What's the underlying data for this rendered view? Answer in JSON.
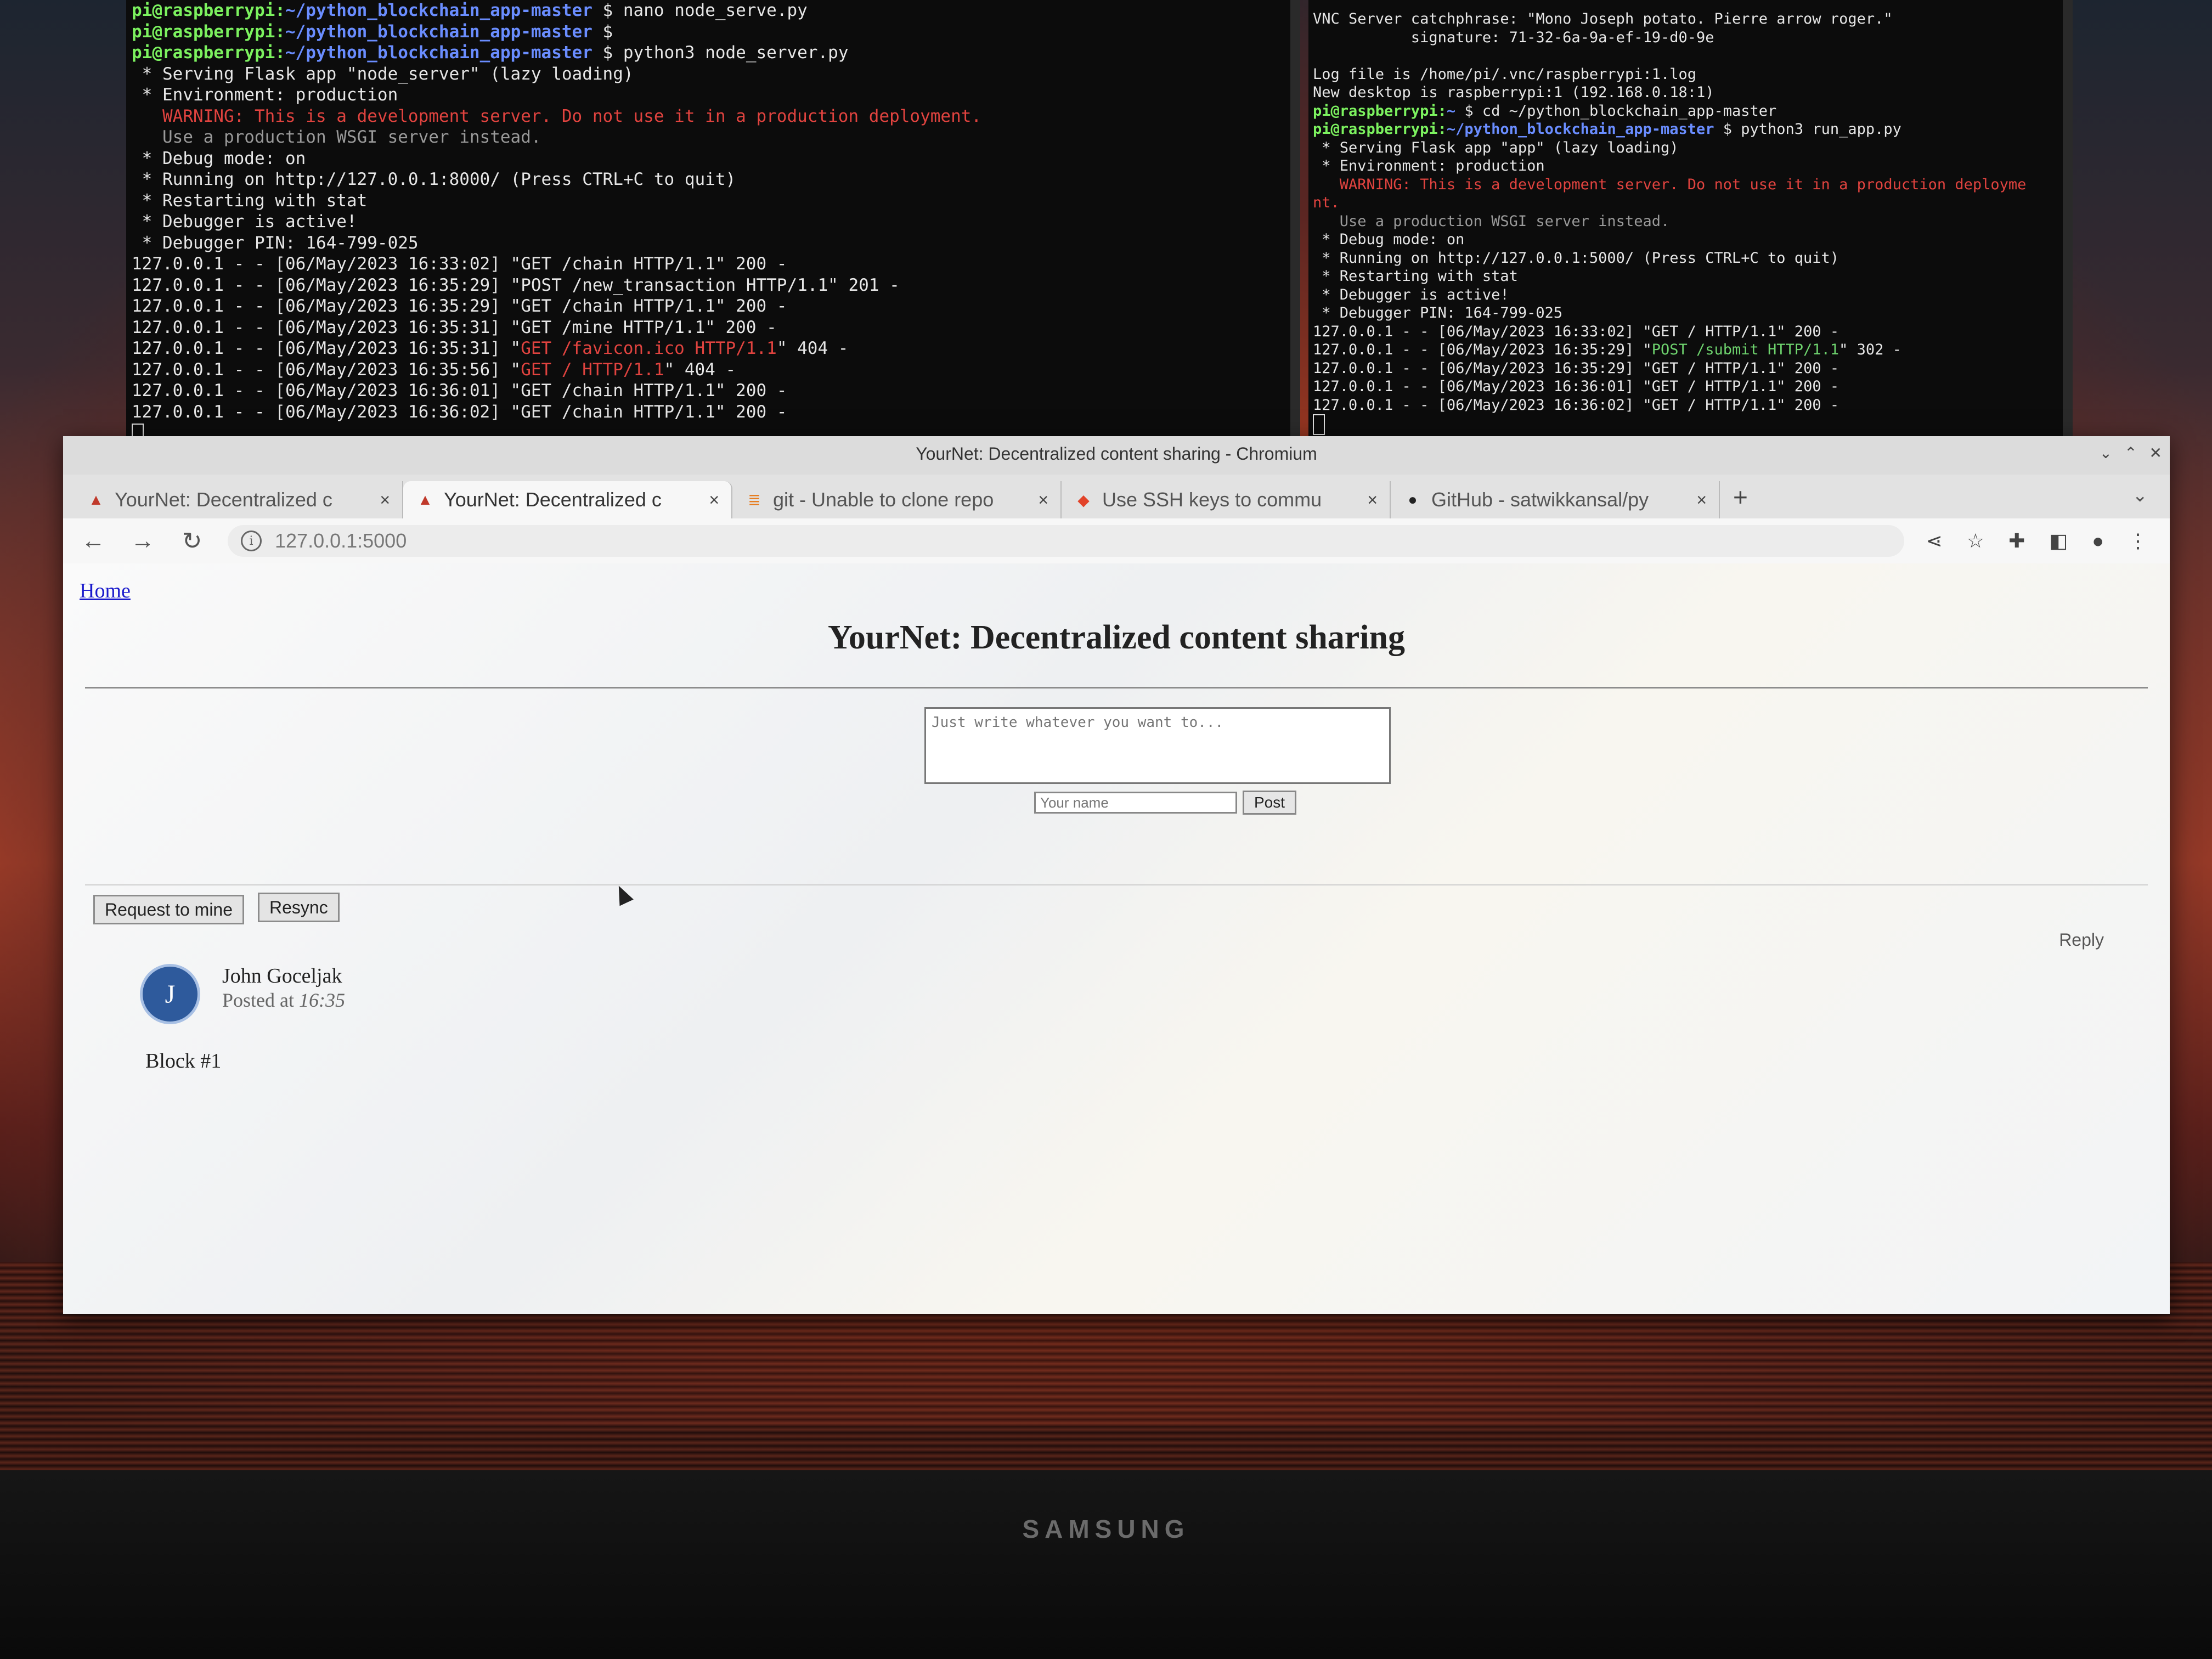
{
  "terminal_left": {
    "lines": [
      {
        "user": "pi@raspberrypi:",
        "path": "~/python_blockchain_app-master",
        "cmd": " $ nano node_serve.py"
      },
      {
        "user": "pi@raspberrypi:",
        "path": "~/python_blockchain_app-master",
        "cmd": " $"
      },
      {
        "user": "pi@raspberrypi:",
        "path": "~/python_blockchain_app-master",
        "cmd": " $ python3 node_server.py"
      }
    ],
    "output": [
      {
        "text": " * Serving Flask app \"node_server\" (lazy loading)",
        "style": ""
      },
      {
        "text": " * Environment: production",
        "style": ""
      },
      {
        "text": "   WARNING: This is a development server. Do not use it in a production deployment.",
        "style": "warn"
      },
      {
        "text": "   Use a production WSGI server instead.",
        "style": "dim"
      },
      {
        "text": " * Debug mode: on",
        "style": ""
      },
      {
        "text": " * Running on http://127.0.0.1:8000/ (Press CTRL+C to quit)",
        "style": ""
      },
      {
        "text": " * Restarting with stat",
        "style": ""
      },
      {
        "text": " * Debugger is active!",
        "style": ""
      },
      {
        "text": " * Debugger PIN: 164-799-025",
        "style": ""
      }
    ],
    "log": [
      {
        "pre": "127.0.0.1 - - [06/May/2023 16:33:02] \"",
        "req": "GET /chain HTTP/1.1",
        "post": "\" 200 -",
        "style": ""
      },
      {
        "pre": "127.0.0.1 - - [06/May/2023 16:35:29] \"",
        "req": "POST /new_transaction HTTP/1.1",
        "post": "\" 201 -",
        "style": ""
      },
      {
        "pre": "127.0.0.1 - - [06/May/2023 16:35:29] \"",
        "req": "GET /chain HTTP/1.1",
        "post": "\" 200 -",
        "style": ""
      },
      {
        "pre": "127.0.0.1 - - [06/May/2023 16:35:31] \"",
        "req": "GET /mine HTTP/1.1",
        "post": "\" 200 -",
        "style": ""
      },
      {
        "pre": "127.0.0.1 - - [06/May/2023 16:35:31] \"",
        "req": "GET /favicon.ico HTTP/1.1",
        "post": "\" 404 -",
        "style": "warn"
      },
      {
        "pre": "127.0.0.1 - - [06/May/2023 16:35:56] \"",
        "req": "GET / HTTP/1.1",
        "post": "\" 404 -",
        "style": "warn"
      },
      {
        "pre": "127.0.0.1 - - [06/May/2023 16:36:01] \"",
        "req": "GET /chain HTTP/1.1",
        "post": "\" 200 -",
        "style": ""
      },
      {
        "pre": "127.0.0.1 - - [06/May/2023 16:36:02] \"",
        "req": "GET /chain HTTP/1.1",
        "post": "\" 200 -",
        "style": ""
      }
    ]
  },
  "terminal_right": {
    "lines": [
      {
        "text": "VNC Server catchphrase: \"Mono Joseph potato. Pierre arrow roger.\"",
        "style": ""
      },
      {
        "text": "           signature: 71-32-6a-9a-ef-19-d0-9e",
        "style": ""
      },
      {
        "text": "",
        "style": ""
      },
      {
        "text": "Log file is /home/pi/.vnc/raspberrypi:1.log",
        "style": ""
      },
      {
        "text": "New desktop is raspberrypi:1 (192.168.0.18:1)",
        "style": ""
      }
    ],
    "prompts": [
      {
        "user": "pi@raspberrypi:",
        "path": "~",
        "cmd": " $ cd ~/python_blockchain_app-master"
      },
      {
        "user": "pi@raspberrypi:",
        "path": "~/python_blockchain_app-master",
        "cmd": " $ python3 run_app.py"
      }
    ],
    "output": [
      {
        "text": " * Serving Flask app \"app\" (lazy loading)",
        "style": ""
      },
      {
        "text": " * Environment: production",
        "style": ""
      },
      {
        "text": "   WARNING: This is a development server. Do not use it in a production deployme",
        "style": "warn"
      },
      {
        "text": "nt.",
        "style": "warn"
      },
      {
        "text": "   Use a production WSGI server instead.",
        "style": "dim"
      },
      {
        "text": " * Debug mode: on",
        "style": ""
      },
      {
        "text": " * Running on http://127.0.0.1:5000/ (Press CTRL+C to quit)",
        "style": ""
      },
      {
        "text": " * Restarting with stat",
        "style": ""
      },
      {
        "text": " * Debugger is active!",
        "style": ""
      },
      {
        "text": " * Debugger PIN: 164-799-025",
        "style": ""
      }
    ],
    "log": [
      {
        "pre": "127.0.0.1 - - [06/May/2023 16:33:02] \"",
        "req": "GET / HTTP/1.1",
        "post": "\" 200 -",
        "style": ""
      },
      {
        "pre": "127.0.0.1 - - [06/May/2023 16:35:29] \"",
        "req": "POST /submit HTTP/1.1",
        "post": "\" 302 -",
        "style": "green"
      },
      {
        "pre": "127.0.0.1 - - [06/May/2023 16:35:29] \"",
        "req": "GET / HTTP/1.1",
        "post": "\" 200 -",
        "style": ""
      },
      {
        "pre": "127.0.0.1 - - [06/May/2023 16:36:01] \"",
        "req": "GET / HTTP/1.1",
        "post": "\" 200 -",
        "style": ""
      },
      {
        "pre": "127.0.0.1 - - [06/May/2023 16:36:02] \"",
        "req": "GET / HTTP/1.1",
        "post": "\" 200 -",
        "style": ""
      }
    ]
  },
  "browser": {
    "window_title": "YourNet: Decentralized content sharing - Chromium",
    "tabs": [
      {
        "label": "YourNet: Decentralized c",
        "icon": "flask-icon"
      },
      {
        "label": "YourNet: Decentralized c",
        "icon": "flask-icon"
      },
      {
        "label": "git - Unable to clone repo",
        "icon": "stackoverflow-icon"
      },
      {
        "label": "Use SSH keys to commu",
        "icon": "gitlab-icon"
      },
      {
        "label": "GitHub - satwikkansal/py",
        "icon": "github-icon"
      }
    ],
    "address": "127.0.0.1:5000"
  },
  "page": {
    "home_link": "Home",
    "heading": "YourNet: Decentralized content sharing",
    "textarea_placeholder": "Just write whatever you want to...",
    "name_placeholder": "Your name",
    "post_button": "Post",
    "request_mine_button": "Request to mine",
    "resync_button": "Resync",
    "post": {
      "avatar_letter": "J",
      "author": "John Goceljak",
      "posted_prefix": "Posted at ",
      "posted_time": "16:35",
      "content": "Block #1",
      "reply": "Reply"
    }
  },
  "monitor_brand": "SAMSUNG"
}
